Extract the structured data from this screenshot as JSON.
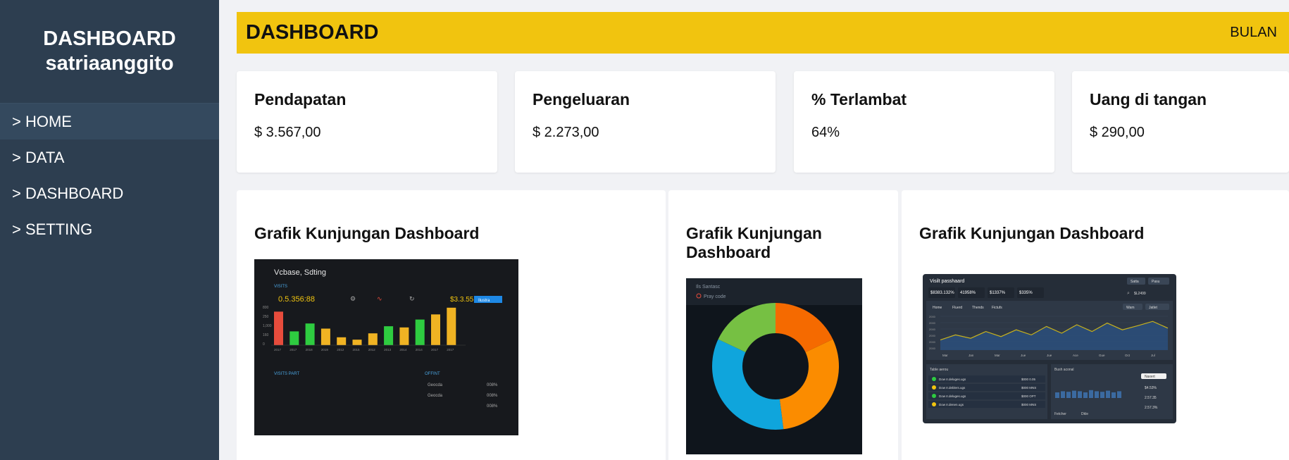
{
  "sidebar": {
    "brand_line1": "DASHBOARD",
    "brand_line2": "satriaanggito",
    "items": [
      {
        "label": "> HOME",
        "active": true
      },
      {
        "label": "> DATA"
      },
      {
        "label": "> DASHBOARD"
      },
      {
        "label": "> SETTING"
      }
    ]
  },
  "header": {
    "title": "DASHBOARD",
    "period": "BULAN"
  },
  "stats": [
    {
      "label": "Pendapatan",
      "value": "$ 3.567,00"
    },
    {
      "label": "Pengeluaran",
      "value": "$ 2.273,00"
    },
    {
      "label": "% Terlambat",
      "value": "64%"
    },
    {
      "label": "Uang di tangan",
      "value": "$ 290,00"
    }
  ],
  "panels": [
    {
      "title": "Grafik Kunjungan Dashboard"
    },
    {
      "title": "Grafik Kunjungan Dashboard"
    },
    {
      "title": "Grafik Kunjungan Dashboard"
    }
  ],
  "thumb1": {
    "heading": "Vcbase, Sdting",
    "sub": "VISITS",
    "big_value": "0.5.356:88",
    "right_value": "$3.3.55",
    "button": "Ilustra",
    "yticks": [
      "800",
      "250",
      "1,000",
      "160",
      "0"
    ],
    "xlabels": [
      "2017",
      "2017",
      "2018",
      "2019",
      "2012",
      "2015",
      "2012",
      "2013",
      "2014",
      "2014",
      "2017",
      "2017"
    ],
    "bars": [
      0.85,
      0.35,
      0.55,
      0.42,
      0.2,
      0.14,
      0.3,
      0.48,
      0.45,
      0.65,
      0.78,
      0.95
    ],
    "bar_colors": [
      "#e74c3c",
      "#2ecc40",
      "#2ecc40",
      "#f0b323",
      "#f0b323",
      "#f0b323",
      "#f0b323",
      "#2ecc40",
      "#f0b323",
      "#2ecc40",
      "#f0b323",
      "#f0b323"
    ],
    "footer_left": "VISITS PART",
    "footer_mid": "OFFINT",
    "rows": [
      {
        "name": "Geocda",
        "pct": "008%"
      },
      {
        "name": "Geocda",
        "pct": "008%"
      },
      {
        "name": "",
        "pct": "008%"
      }
    ]
  },
  "thumb2": {
    "top_label": "Ils Santasc",
    "sub_label": "Pray code",
    "slices": [
      {
        "value": 18,
        "color": "#f56a00"
      },
      {
        "value": 30,
        "color": "#fb8c00"
      },
      {
        "value": 34,
        "color": "#0fa5dc"
      },
      {
        "value": 18,
        "color": "#76c043"
      }
    ]
  },
  "thumb3": {
    "title": "Visilt passhaard",
    "btn1": "Satta",
    "btn2": "Pasu",
    "stats": [
      "$8383.132%",
      "41958%",
      "$1337%",
      "$335%"
    ],
    "search_value": "$L2499",
    "tabs": [
      "Home",
      "Fluerd",
      "Thends",
      "Fictufs"
    ],
    "chip1": "Wam",
    "chip2": "Jatlet",
    "months": [
      "Mar",
      "Jan",
      "Mar",
      "Jue",
      "Jue",
      "Ace",
      "Gue",
      "Oct",
      "Jul"
    ],
    "yticks": [
      "2000",
      "2000",
      "2000",
      "2000",
      "2000",
      "2000"
    ],
    "line_values": [
      0.3,
      0.45,
      0.35,
      0.55,
      0.4,
      0.6,
      0.45,
      0.7,
      0.5,
      0.75,
      0.55,
      0.8,
      0.6,
      0.72,
      0.85,
      0.65
    ],
    "list_header_left": "Table aerou",
    "list_header_right": "Bush aconal",
    "list_rows": [
      {
        "name": "Dow Ir.deluges.ugs",
        "val": "$000 0.05",
        "color": "#2ecc40"
      },
      {
        "name": "Dow Ir.deblers.ugs",
        "val": "$000 MNS",
        "color": "#f1c40f"
      },
      {
        "name": "Dow Ir.deluges.ugs",
        "val": "$000 OPT",
        "color": "#2ecc40"
      },
      {
        "name": "Dow Ir.denen.ugs",
        "val": "$000 MNS",
        "color": "#f1c40f"
      }
    ],
    "mini_bars": [
      0.5,
      0.6,
      0.55,
      0.65,
      0.6,
      0.5,
      0.7,
      0.6,
      0.55,
      0.65,
      0.5,
      0.6
    ],
    "right_values": [
      "$4.53%",
      "2.57.35",
      "2.57.3%"
    ],
    "right_chip": "Naxert",
    "footer_left": "Fetcher",
    "footer_mid": "Dkle"
  }
}
